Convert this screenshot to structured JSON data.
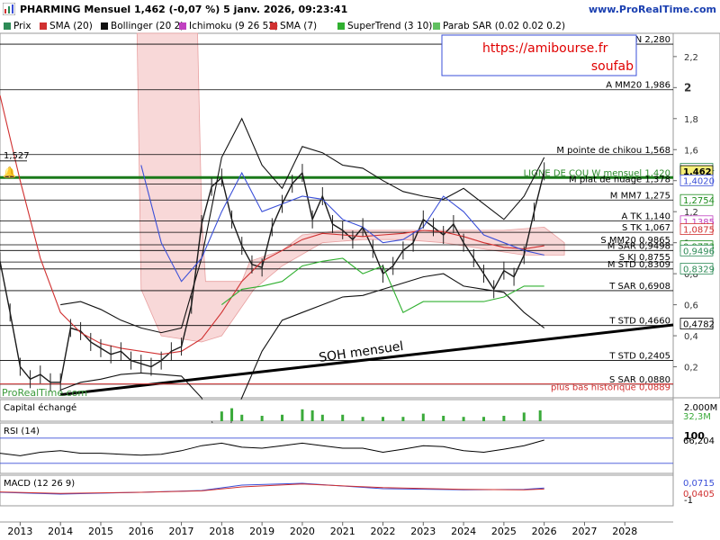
{
  "header": {
    "title": "PHARMING Mensuel 1,462 (-0,07 %) 5 janv. 2026, 09:23:41",
    "site": "www.ProRealTime.com",
    "watermark": "ProRealTime.com"
  },
  "legend": [
    {
      "label": "Prix",
      "color": "#2e8b57"
    },
    {
      "label": "SMA (20)",
      "color": "#d03030"
    },
    {
      "label": "Bollinger (20 2)",
      "color": "#111111"
    },
    {
      "label": "Ichimoku (9 26 52)",
      "color": "#c040c0"
    },
    {
      "label": "SMA (7)",
      "color": "#d03030"
    },
    {
      "label": "SuperTrend (3 10)",
      "color": "#30b030"
    },
    {
      "label": "Parab SAR (0.02 0.02 0.2)",
      "color": "#60c060"
    }
  ],
  "annotations": {
    "url_box_text": "https://amibourse.fr",
    "author": "soufab",
    "trendline_label": "SOH mensuel",
    "hist_label": "plus bas historique 0,0889"
  },
  "chart_data": [
    {
      "type": "line",
      "panel": "price",
      "title": "PHARMING Mensuel",
      "ylim": [
        0.0,
        2.35
      ],
      "yticks": [
        "2,2",
        "2",
        "1,8",
        "1,6",
        "1,4",
        "1,2",
        "1",
        "0,8",
        "0,6",
        "0,4",
        "0,2"
      ],
      "xlim": [
        2012.5,
        2029.2
      ],
      "xticks": [
        "2013",
        "2014",
        "2015",
        "2016",
        "2017",
        "2018",
        "2019",
        "2020",
        "2021",
        "2022",
        "2023",
        "2024",
        "2025",
        "2026",
        "2027",
        "2028"
      ],
      "last_price_label": "1,462",
      "left_marker": "1,527",
      "series": [
        {
          "name": "Prix",
          "color": "#1a1a1a",
          "x": [
            2012.5,
            2012.75,
            2013.0,
            2013.25,
            2013.5,
            2013.75,
            2014.0,
            2014.25,
            2014.5,
            2014.75,
            2015.0,
            2015.25,
            2015.5,
            2015.75,
            2016.0,
            2016.25,
            2016.5,
            2016.75,
            2017.0,
            2017.25,
            2017.5,
            2017.75,
            2018.0,
            2018.25,
            2018.5,
            2018.75,
            2019.0,
            2019.25,
            2019.5,
            2019.75,
            2020.0,
            2020.25,
            2020.5,
            2020.75,
            2021.0,
            2021.25,
            2021.5,
            2021.75,
            2022.0,
            2022.25,
            2022.5,
            2022.75,
            2023.0,
            2023.25,
            2023.5,
            2023.75,
            2024.0,
            2024.25,
            2024.5,
            2024.75,
            2025.0,
            2025.25,
            2025.5,
            2025.75,
            2026.0
          ],
          "y": [
            0.88,
            0.55,
            0.2,
            0.12,
            0.15,
            0.1,
            0.1,
            0.45,
            0.43,
            0.36,
            0.32,
            0.28,
            0.3,
            0.24,
            0.22,
            0.2,
            0.24,
            0.3,
            0.33,
            0.6,
            1.12,
            1.36,
            1.42,
            1.15,
            0.98,
            0.86,
            0.84,
            1.1,
            1.25,
            1.38,
            1.45,
            1.15,
            1.3,
            1.12,
            1.08,
            1.02,
            1.1,
            0.96,
            0.8,
            0.85,
            0.95,
            1.0,
            1.15,
            1.1,
            1.05,
            1.12,
            1.0,
            0.9,
            0.8,
            0.7,
            0.82,
            0.78,
            0.92,
            1.2,
            1.46
          ]
        },
        {
          "name": "SMA (20)",
          "color": "#d03030",
          "x": [
            2012.5,
            2013.0,
            2013.5,
            2014.0,
            2014.5,
            2015.0,
            2015.5,
            2016.0,
            2016.5,
            2017.0,
            2017.5,
            2018.0,
            2018.5,
            2019.0,
            2019.5,
            2020.0,
            2020.5,
            2021.0,
            2021.5,
            2022.0,
            2022.5,
            2023.0,
            2023.5,
            2024.0,
            2024.5,
            2025.0,
            2025.5,
            2026.0
          ],
          "y": [
            1.95,
            1.4,
            0.9,
            0.55,
            0.42,
            0.35,
            0.32,
            0.3,
            0.28,
            0.3,
            0.38,
            0.55,
            0.75,
            0.88,
            0.95,
            1.02,
            1.06,
            1.05,
            1.04,
            1.05,
            1.06,
            1.08,
            1.07,
            1.04,
            1.0,
            0.97,
            0.96,
            0.98
          ]
        },
        {
          "name": "Bollinger haute",
          "color": "#111111",
          "x": [
            2014.0,
            2014.5,
            2015.0,
            2015.5,
            2016.0,
            2016.5,
            2017.0,
            2017.5,
            2018.0,
            2018.5,
            2019.0,
            2019.5,
            2020.0,
            2020.5,
            2021.0,
            2021.5,
            2022.0,
            2022.5,
            2023.0,
            2023.5,
            2024.0,
            2024.5,
            2025.0,
            2025.5,
            2026.0
          ],
          "y": [
            0.6,
            0.62,
            0.57,
            0.5,
            0.45,
            0.42,
            0.45,
            0.9,
            1.55,
            1.8,
            1.5,
            1.35,
            1.62,
            1.58,
            1.5,
            1.48,
            1.4,
            1.33,
            1.3,
            1.28,
            1.35,
            1.25,
            1.15,
            1.3,
            1.55
          ]
        },
        {
          "name": "Bollinger basse",
          "color": "#111111",
          "x": [
            2014.0,
            2014.5,
            2015.0,
            2015.5,
            2016.0,
            2016.5,
            2017.0,
            2017.5,
            2018.0,
            2018.5,
            2019.0,
            2019.5,
            2020.0,
            2020.5,
            2021.0,
            2021.5,
            2022.0,
            2022.5,
            2023.0,
            2023.5,
            2024.0,
            2024.5,
            2025.0,
            2025.5,
            2026.0
          ],
          "y": [
            0.05,
            0.1,
            0.12,
            0.15,
            0.16,
            0.15,
            0.14,
            0.0,
            -0.3,
            0.0,
            0.3,
            0.5,
            0.55,
            0.6,
            0.65,
            0.66,
            0.7,
            0.74,
            0.78,
            0.8,
            0.72,
            0.7,
            0.68,
            0.55,
            0.45
          ]
        },
        {
          "name": "Ichimoku",
          "color": "#3a4fd8",
          "x": [
            2016.0,
            2016.5,
            2017.0,
            2017.5,
            2018.0,
            2018.5,
            2019.0,
            2019.5,
            2020.0,
            2020.5,
            2021.0,
            2021.5,
            2022.0,
            2022.5,
            2023.0,
            2023.5,
            2024.0,
            2024.5,
            2025.0,
            2025.5,
            2026.0
          ],
          "y": [
            1.5,
            1.0,
            0.75,
            0.9,
            1.2,
            1.45,
            1.2,
            1.25,
            1.3,
            1.28,
            1.15,
            1.1,
            1.0,
            1.02,
            1.1,
            1.3,
            1.2,
            1.05,
            1.0,
            0.95,
            0.92
          ]
        },
        {
          "name": "SuperTrend (3 10)",
          "color": "#30b030",
          "x": [
            2018.0,
            2018.5,
            2019.0,
            2019.5,
            2020.0,
            2020.5,
            2021.0,
            2021.5,
            2022.0,
            2022.5,
            2023.0,
            2023.5,
            2024.0,
            2024.5,
            2025.0,
            2025.5,
            2026.0
          ],
          "y": [
            0.6,
            0.7,
            0.72,
            0.75,
            0.85,
            0.88,
            0.9,
            0.8,
            0.85,
            0.55,
            0.62,
            0.62,
            0.62,
            0.62,
            0.65,
            0.72,
            0.72
          ]
        }
      ],
      "levels": [
        {
          "label": "M PDN 2,280",
          "value": 2.28,
          "color": "#000000"
        },
        {
          "label": "A MM20 1,986",
          "value": 1.986,
          "color": "#000000"
        },
        {
          "label": "M pointe de chikou 1,568",
          "value": 1.568,
          "color": "#000000"
        },
        {
          "label": "LIGNE DE COU W mensuel 1,420",
          "value": 1.42,
          "color": "#1a7a1a"
        },
        {
          "label": "M plat de nuage 1,378",
          "value": 1.378,
          "color": "#000000"
        },
        {
          "label": "M MM7 1,275",
          "value": 1.275,
          "color": "#000000"
        },
        {
          "label": "A TK 1,140",
          "value": 1.14,
          "color": "#000000"
        },
        {
          "label": "S TK 1,067",
          "value": 1.067,
          "color": "#000000"
        },
        {
          "label": "S MM20 0,9865",
          "value": 0.9865,
          "color": "#000000"
        },
        {
          "label": "M SAR 0,9498",
          "value": 0.9498,
          "color": "#000000"
        },
        {
          "label": "S KJ 0,8755",
          "value": 0.8755,
          "color": "#000000"
        },
        {
          "label": "M STD 0,8309",
          "value": 0.8309,
          "color": "#000000"
        },
        {
          "label": "T SAR 0,6908",
          "value": 0.6908,
          "color": "#000000"
        },
        {
          "label": "T STD 0,4660",
          "value": 0.466,
          "color": "#000000"
        },
        {
          "label": "T STD 0,2405",
          "value": 0.2405,
          "color": "#000000"
        },
        {
          "label": "S SAR 0,0880",
          "value": 0.088,
          "color": "#000000"
        }
      ],
      "price_tags": [
        {
          "text": "1,4764",
          "value": 1.4764,
          "color": "#2e8b57"
        },
        {
          "text": "1,462",
          "value": 1.462,
          "color": "#000000",
          "bg": "#f7f07a"
        },
        {
          "text": "1,4020",
          "value": 1.402,
          "color": "#3a4fd8"
        },
        {
          "text": "1,2754",
          "value": 1.2754,
          "color": "#1a8a1a"
        },
        {
          "text": "1,1385",
          "value": 1.1385,
          "color": "#c040c0"
        },
        {
          "text": "1,0875",
          "value": 1.0875,
          "color": "#d03030"
        },
        {
          "text": "0,9773",
          "value": 0.9773,
          "color": "#1a8a1a"
        },
        {
          "text": "0,9496",
          "value": 0.9496,
          "color": "#2e8b57"
        },
        {
          "text": "0,8329",
          "value": 0.8329,
          "color": "#2e8b57"
        },
        {
          "text": "0,4782",
          "value": 0.4782,
          "color": "#000000"
        }
      ]
    },
    {
      "type": "bar",
      "panel": "volume",
      "title": "Capital échangé",
      "ytick": "2.000M",
      "last_label": "32,3M",
      "series": [
        {
          "name": "Capital échangé",
          "color": "#3aaa3a",
          "x": [
            2018.0,
            2018.25,
            2018.5,
            2019.0,
            2019.5,
            2020.0,
            2020.25,
            2020.5,
            2021.0,
            2021.5,
            2022.0,
            2022.5,
            2023.0,
            2023.5,
            2024.0,
            2024.5,
            2025.0,
            2025.5,
            2025.9
          ],
          "values": [
            0.45,
            0.6,
            0.3,
            0.25,
            0.3,
            0.55,
            0.5,
            0.3,
            0.3,
            0.2,
            0.2,
            0.2,
            0.35,
            0.25,
            0.2,
            0.2,
            0.25,
            0.4,
            0.5
          ]
        }
      ]
    },
    {
      "type": "line",
      "panel": "rsi",
      "title": "RSI (14)",
      "ytick": "100",
      "last_label": "66,204",
      "ylim": [
        0,
        100
      ],
      "series": [
        {
          "name": "RSI (14)",
          "color": "#000000",
          "x": [
            2012.5,
            2013.0,
            2013.5,
            2014.0,
            2014.5,
            2015.0,
            2015.5,
            2016.0,
            2016.5,
            2017.0,
            2017.5,
            2018.0,
            2018.5,
            2019.0,
            2019.5,
            2020.0,
            2020.5,
            2021.0,
            2021.5,
            2022.0,
            2022.5,
            2023.0,
            2023.5,
            2024.0,
            2024.5,
            2025.0,
            2025.5,
            2026.0
          ],
          "values": [
            40,
            35,
            42,
            45,
            40,
            40,
            38,
            36,
            38,
            45,
            55,
            60,
            52,
            50,
            55,
            60,
            55,
            50,
            50,
            42,
            48,
            55,
            53,
            45,
            42,
            48,
            55,
            66
          ]
        }
      ]
    },
    {
      "type": "line",
      "panel": "macd",
      "title": "MACD (12 26 9)",
      "ytick": "-1",
      "last_labels": [
        "0,0715",
        "0,0405"
      ],
      "series": [
        {
          "name": "MACD",
          "color": "#3a4fd8",
          "x": [
            2012.5,
            2014.0,
            2016.0,
            2017.5,
            2018.5,
            2020.0,
            2022.0,
            2024.0,
            2025.5,
            2026.0
          ],
          "values": [
            -0.05,
            -0.1,
            -0.05,
            0.0,
            0.15,
            0.2,
            0.05,
            0.02,
            0.03,
            0.07
          ]
        },
        {
          "name": "Signal",
          "color": "#d03030",
          "x": [
            2012.5,
            2014.0,
            2016.0,
            2017.5,
            2018.5,
            2020.0,
            2022.0,
            2024.0,
            2025.5,
            2026.0
          ],
          "values": [
            -0.04,
            -0.08,
            -0.05,
            -0.01,
            0.1,
            0.18,
            0.08,
            0.03,
            0.02,
            0.04
          ]
        }
      ]
    }
  ]
}
